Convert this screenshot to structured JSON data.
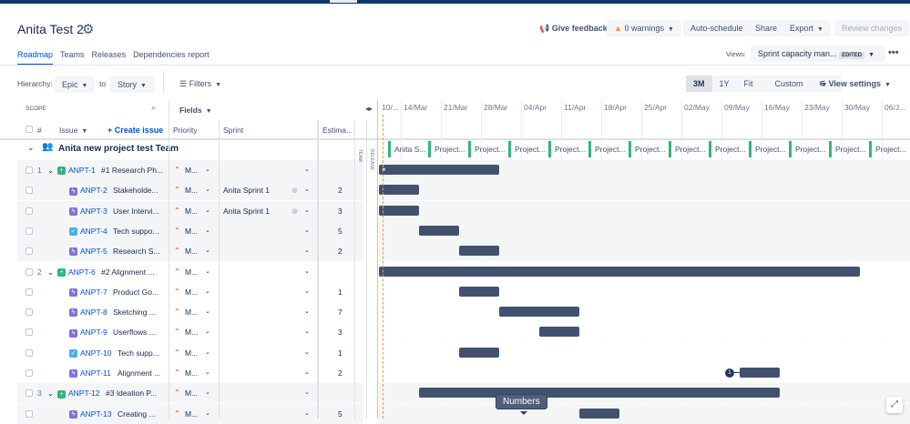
{
  "header": {
    "title": "Anita Test 2",
    "tabs": [
      "Roadmap",
      "Teams",
      "Releases",
      "Dependencies report"
    ],
    "give_feedback": "Give feedback",
    "warnings": "0 warnings",
    "auto_schedule": "Auto-schedule",
    "share": "Share",
    "export": "Export",
    "review_changes": "Review changes",
    "views_label": "Views:",
    "view_name": "Sprint capacity man...",
    "edited": "EDITED"
  },
  "toolbar": {
    "hierarchy_label": "Hierarchy:",
    "from": "Epic",
    "to_label": "to",
    "to": "Story",
    "filters": "Filters",
    "ranges": [
      "3M",
      "1Y",
      "Fit",
      "Custom"
    ],
    "view_settings": "View settings"
  },
  "table": {
    "scope": "SCOPE",
    "fields": "Fields",
    "hash": "#",
    "issue": "Issue",
    "create_issue": "+ Create issue",
    "priority": "Priority",
    "sprint": "Sprint",
    "estimate": "Estima...",
    "team_strip": "TEAM",
    "release_strip": "RELEASE",
    "group": "Anita new project test Team",
    "rows": [
      {
        "num": "1",
        "type": "epic",
        "key": "ANPT-1",
        "summary": "#1 Research Ph...",
        "priority": "M...",
        "sprint": "",
        "estimate": "",
        "start": 0,
        "weeks": 3
      },
      {
        "num": "",
        "type": "story",
        "key": "ANPT-2",
        "summary": "Stakeholde...",
        "priority": "M...",
        "sprint": "Anita Sprint 1",
        "estimate": "2",
        "start": 0,
        "weeks": 1
      },
      {
        "num": "",
        "type": "story",
        "key": "ANPT-3",
        "summary": "User Intervi...",
        "priority": "M...",
        "sprint": "Anita Sprint 1",
        "estimate": "3",
        "start": 0,
        "weeks": 1
      },
      {
        "num": "",
        "type": "task",
        "key": "ANPT-4",
        "summary": "Tech suppo...",
        "priority": "M...",
        "sprint": "",
        "estimate": "5",
        "start": 1,
        "weeks": 1
      },
      {
        "num": "",
        "type": "story",
        "key": "ANPT-5",
        "summary": "Research S...",
        "priority": "M...",
        "sprint": "",
        "estimate": "2",
        "start": 2,
        "weeks": 1
      },
      {
        "num": "2",
        "type": "epic",
        "key": "ANPT-6",
        "summary": "#2 Alignment ...",
        "priority": "M...",
        "sprint": "",
        "estimate": "",
        "start": 0,
        "weeks": 12
      },
      {
        "num": "",
        "type": "story",
        "key": "ANPT-7",
        "summary": "Product Go...",
        "priority": "M...",
        "sprint": "",
        "estimate": "1",
        "start": 2,
        "weeks": 1
      },
      {
        "num": "",
        "type": "story",
        "key": "ANPT-8",
        "summary": "Sketching ...",
        "priority": "M...",
        "sprint": "",
        "estimate": "7",
        "start": 3,
        "weeks": 2
      },
      {
        "num": "",
        "type": "story",
        "key": "ANPT-9",
        "summary": "Userflows ...",
        "priority": "M...",
        "sprint": "",
        "estimate": "3",
        "start": 4,
        "weeks": 1
      },
      {
        "num": "",
        "type": "task",
        "key": "ANPT-10",
        "summary": "Tech supp...",
        "priority": "M...",
        "sprint": "",
        "estimate": "1",
        "start": 2,
        "weeks": 1
      },
      {
        "num": "",
        "type": "story",
        "key": "ANPT-11",
        "summary": "Alignment ...",
        "priority": "M...",
        "sprint": "",
        "estimate": "2",
        "start": 9,
        "weeks": 1,
        "dependency": "1"
      },
      {
        "num": "3",
        "type": "epic",
        "key": "ANPT-12",
        "summary": "#3 Ideation P...",
        "priority": "M...",
        "sprint": "",
        "estimate": "",
        "start": 1,
        "weeks": 9
      },
      {
        "num": "",
        "type": "story",
        "key": "ANPT-13",
        "summary": "Creating ...",
        "priority": "M...",
        "sprint": "",
        "estimate": "5",
        "start": 5,
        "weeks": 1
      }
    ]
  },
  "timeline": {
    "weeks": [
      "10/...",
      "14/Mar",
      "21/Mar",
      "28/Mar",
      "04/Apr",
      "11/Apr",
      "18/Apr",
      "25/Apr",
      "02/May",
      "09/May",
      "16/May",
      "23/May",
      "30/May",
      "06/J..."
    ],
    "sprints": [
      "Anita S...",
      "Project...",
      "Project...",
      "Project...",
      "Project...",
      "Project...",
      "Project...",
      "Project...",
      "Project...",
      "Project...",
      "Project...",
      "Project...",
      "Project..."
    ]
  },
  "tooltip": "Numbers"
}
